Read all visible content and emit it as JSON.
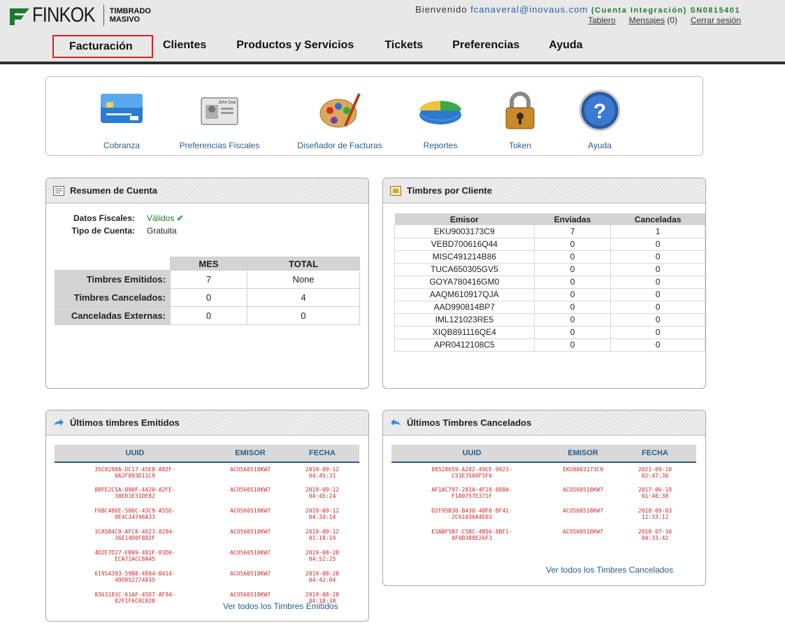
{
  "brand": {
    "name": "FINKOK",
    "sub_line1": "TIMBRADO",
    "sub_line2": "MASIVO",
    "color": "#1e7a2e"
  },
  "header": {
    "welcome": "Bienvenido",
    "email": "fcanaveral@inovaus.com",
    "account": "(Cuenta Integración) SN0815401",
    "links": {
      "tablero": "Tablero",
      "mensajes": "Mensajes",
      "mensajes_count": "(0)",
      "cerrar": "Cerrar sesión"
    }
  },
  "nav": {
    "facturacion": "Facturación",
    "clientes": "Clientes",
    "productos": "Productos y Servicios",
    "tickets": "Tickets",
    "preferencias": "Preferencias",
    "ayuda": "Ayuda"
  },
  "quick": {
    "cobranza": "Cobranza",
    "pref_fiscales": "Preferencias Fiscales",
    "disenador": "Diseñador de Facturas",
    "reportes": "Reportes",
    "token": "Token",
    "ayuda": "Ayuda",
    "id_card_text": "John Doe"
  },
  "resumen": {
    "title": "Resumen de Cuenta",
    "datos_label": "Datos Fiscales:",
    "datos_value": "Válidos",
    "tipo_label": "Tipo de Cuenta:",
    "tipo_value": "Gratuita",
    "col_mes": "MES",
    "col_total": "TOTAL",
    "rows": [
      {
        "label": "Timbres Emitidos:",
        "mes": "7",
        "total": "None"
      },
      {
        "label": "Timbres Cancelados:",
        "mes": "0",
        "total": "4"
      },
      {
        "label": "Canceladas Externas:",
        "mes": "0",
        "total": "0"
      }
    ]
  },
  "clientes": {
    "title": "Timbres por Cliente",
    "col_emisor": "Emisor",
    "col_enviadas": "Enviadas",
    "col_canceladas": "Canceladas",
    "rows": [
      {
        "emisor": "EKU9003173C9",
        "enviadas": "7",
        "canceladas": "1"
      },
      {
        "emisor": "VEBD700616Q44",
        "enviadas": "0",
        "canceladas": "0"
      },
      {
        "emisor": "MISC491214B86",
        "enviadas": "0",
        "canceladas": "0"
      },
      {
        "emisor": "TUCA650305GV5",
        "enviadas": "0",
        "canceladas": "0"
      },
      {
        "emisor": "GOYA780416GM0",
        "enviadas": "0",
        "canceladas": "0"
      },
      {
        "emisor": "AAQM610917QJA",
        "enviadas": "0",
        "canceladas": "0"
      },
      {
        "emisor": "AAD990814BP7",
        "enviadas": "0",
        "canceladas": "0"
      },
      {
        "emisor": "IML121023RE5",
        "enviadas": "0",
        "canceladas": "0"
      },
      {
        "emisor": "XIQB891116QE4",
        "enviadas": "0",
        "canceladas": "0"
      },
      {
        "emisor": "APR0412108C5",
        "enviadas": "0",
        "canceladas": "0"
      }
    ]
  },
  "emitidos": {
    "title": "Últimos timbres Emitidos",
    "col_uuid": "UUID",
    "col_emisor": "EMISOR",
    "col_fecha": "FECHA",
    "ver_todos": "Ver todos los Timbres Emitidos",
    "rows": [
      {
        "uuid1": "35C8298A-DC17-45E8-A92F-",
        "uuid2": "0A2F893D11C9",
        "emisor": "ACO560518KW7",
        "fecha1": "2019-09-12",
        "fecha2": "04:45:31"
      },
      {
        "uuid1": "88FE2C5A-890F-4420-A2FE-",
        "uuid2": "38ED1E31DE82",
        "emisor": "ACO560518KW7",
        "fecha1": "2019-09-12",
        "fecha2": "04:45:24"
      },
      {
        "uuid1": "F6BC486E-586C-43C9-A55D-",
        "uuid2": "0E4C34746A33",
        "emisor": "ACO560518KW7",
        "fecha1": "2019-09-12",
        "fecha2": "04:34:14"
      },
      {
        "uuid1": "1CA584C9-AFC8-4623-8294-",
        "uuid2": "36E14D0F882F",
        "emisor": "ACO560518KW7",
        "fecha1": "2019-09-12",
        "fecha2": "01:18:19"
      },
      {
        "uuid1": "4D2E7D27-EB99-481F-83D0-",
        "uuid2": "ECA71ACC8A45",
        "emisor": "ACO560518KW7",
        "fecha1": "2019-08-28",
        "fecha2": "04:52:25"
      },
      {
        "uuid1": "61954393-59B8-4894-B414-",
        "uuid2": "49D852274835",
        "emisor": "ACO560518KW7",
        "fecha1": "2019-08-28",
        "fecha2": "04:42:04"
      },
      {
        "uuid1": "8363183C-61AF-45D7-AF94-",
        "uuid2": "82F1F6C8C828",
        "emisor": "ACO560518KW7",
        "fecha1": "2019-08-28",
        "fecha2": "04:18:38"
      }
    ]
  },
  "cancelados": {
    "title": "Últimos Timbres Cancelados",
    "col_uuid": "UUID",
    "col_emisor": "EMISOR",
    "col_fecha": "FECHA",
    "ver_todos": "Ver todos los Timbres Cancelados",
    "rows": [
      {
        "uuid1": "88528659-A202-49CE-9923-",
        "uuid2": "C51E3560F5F0",
        "emisor": "EKU9003173C9",
        "fecha1": "2021-09-10",
        "fecha2": "02:47:38"
      },
      {
        "uuid1": "AF1AC797-281A-4F18-888A-",
        "uuid2": "F1A9757E371F",
        "emisor": "ACO560518KW7",
        "fecha1": "2017-06-19",
        "fecha2": "01:48:38"
      },
      {
        "uuid1": "D2F95B30-B430-48F8-BF41-",
        "uuid2": "2C61036A4E03",
        "emisor": "ACO560518KW7",
        "fecha1": "2018-09-03",
        "fecha2": "12:33:12"
      },
      {
        "uuid1": "E3ABF5B7-C5BC-4B56-8BF1-",
        "uuid2": "AF0D388E26F3",
        "emisor": "ACO560518KW7",
        "fecha1": "2018-07-30",
        "fecha2": "04:33:42"
      }
    ]
  }
}
